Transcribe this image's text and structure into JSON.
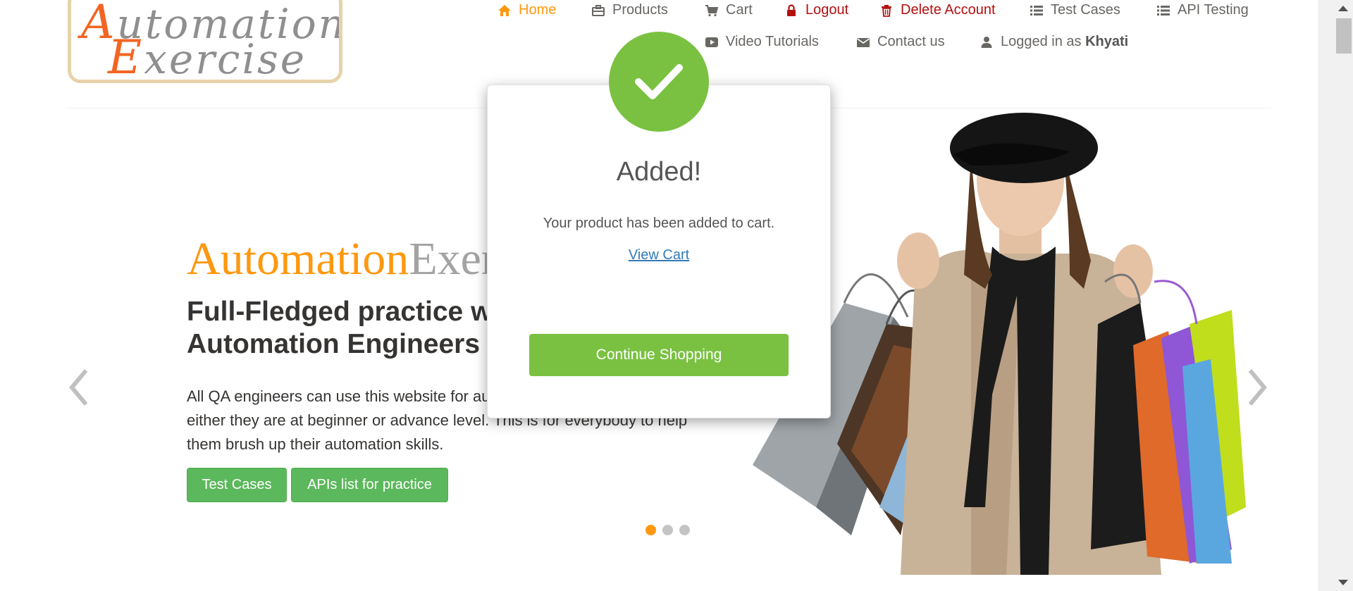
{
  "logo": {
    "line1_cap": "A",
    "line1_rest": "utomation",
    "line2_cap": "E",
    "line2_rest": "xercise",
    "colors": {
      "cap": "#f26522",
      "rest": "#8f8f8f",
      "border": "#e6d3a9"
    }
  },
  "nav": {
    "home": "Home",
    "products": "Products",
    "cart": "Cart",
    "logout": "Logout",
    "delete_account": "Delete Account",
    "test_cases": "Test Cases",
    "api_testing": "API Testing",
    "video_tutorials": "Video Tutorials",
    "contact_us": "Contact us",
    "logged_in_prefix": "Logged in as",
    "logged_in_user": "Khyati",
    "colors": {
      "active": "#fe980f",
      "danger": "#b31010",
      "default": "#696763"
    }
  },
  "slider": {
    "brand_part1": "Automation",
    "brand_part2": "Exercise",
    "headline_line1": "Full-Fledged practice website for",
    "headline_line2": "Automation Engineers",
    "description": "All QA engineers can use this website for automation practice and API testing either they are at beginner or advance level. This is for everybody to help them brush up their automation skills.",
    "btn_test_cases": "Test Cases",
    "btn_apis": "APIs list for practice",
    "active_dot": 1,
    "dot_count": 3,
    "colors": {
      "orange": "#fe980f",
      "green_button": "#5cb85c"
    }
  },
  "modal": {
    "icon": "check-icon",
    "title": "Added!",
    "message": "Your product has been added to cart.",
    "view_cart": "View Cart",
    "continue_shopping": "Continue Shopping",
    "colors": {
      "success": "#7ac142",
      "link": "#337ab7"
    }
  }
}
